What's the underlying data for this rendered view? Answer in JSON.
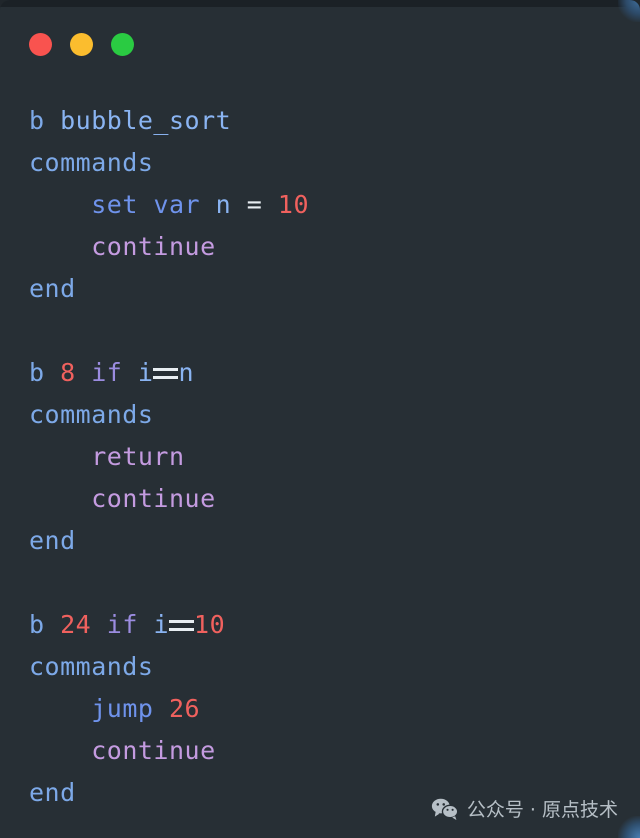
{
  "window": {
    "titlebar": {
      "buttons": [
        {
          "name": "close",
          "label": "Close",
          "color": "#f9534f"
        },
        {
          "name": "minimize",
          "label": "Minimize",
          "color": "#fbbd2e"
        },
        {
          "name": "maximize",
          "label": "Maximize",
          "color": "#2acb42"
        }
      ]
    },
    "background_color": "#272f35"
  },
  "editor": {
    "language": "debugger-script",
    "syntax_colors": {
      "command": "#7da9e8",
      "identifier": "#8ab4f2",
      "number": "#f0615e",
      "keyword": "#c49be0",
      "conditional": "#9b8ce0",
      "operator": "#e8eef2",
      "builtin": "#6f93ec"
    },
    "lines": [
      {
        "n": 1,
        "indent": 0,
        "tokens": [
          {
            "t": "b",
            "c": "cmd"
          },
          {
            "t": " ",
            "c": "plain"
          },
          {
            "t": "bubble_sort",
            "c": "ident"
          }
        ]
      },
      {
        "n": 2,
        "indent": 0,
        "tokens": [
          {
            "t": "commands",
            "c": "cmd"
          }
        ]
      },
      {
        "n": 3,
        "indent": 1,
        "tokens": [
          {
            "t": "set",
            "c": "set"
          },
          {
            "t": " ",
            "c": "plain"
          },
          {
            "t": "var",
            "c": "set"
          },
          {
            "t": " ",
            "c": "plain"
          },
          {
            "t": "n",
            "c": "ident"
          },
          {
            "t": " ",
            "c": "plain"
          },
          {
            "t": "=",
            "c": "op"
          },
          {
            "t": " ",
            "c": "plain"
          },
          {
            "t": "10",
            "c": "num"
          }
        ]
      },
      {
        "n": 4,
        "indent": 1,
        "tokens": [
          {
            "t": "continue",
            "c": "kw"
          }
        ]
      },
      {
        "n": 5,
        "indent": 0,
        "tokens": [
          {
            "t": "end",
            "c": "cmd"
          }
        ]
      },
      {
        "n": 6,
        "indent": 0,
        "blank": true,
        "tokens": []
      },
      {
        "n": 7,
        "indent": 0,
        "tokens": [
          {
            "t": "b",
            "c": "cmd"
          },
          {
            "t": " ",
            "c": "plain"
          },
          {
            "t": "8",
            "c": "num"
          },
          {
            "t": " ",
            "c": "plain"
          },
          {
            "t": "if",
            "c": "cond"
          },
          {
            "t": " ",
            "c": "plain"
          },
          {
            "t": "i",
            "c": "ident"
          },
          {
            "t": "==",
            "c": "eqeq"
          },
          {
            "t": "n",
            "c": "ident"
          }
        ]
      },
      {
        "n": 8,
        "indent": 0,
        "tokens": [
          {
            "t": "commands",
            "c": "cmd"
          }
        ]
      },
      {
        "n": 9,
        "indent": 1,
        "tokens": [
          {
            "t": "return",
            "c": "kw"
          }
        ]
      },
      {
        "n": 10,
        "indent": 1,
        "tokens": [
          {
            "t": "continue",
            "c": "kw"
          }
        ]
      },
      {
        "n": 11,
        "indent": 0,
        "tokens": [
          {
            "t": "end",
            "c": "cmd"
          }
        ]
      },
      {
        "n": 12,
        "indent": 0,
        "blank": true,
        "tokens": []
      },
      {
        "n": 13,
        "indent": 0,
        "tokens": [
          {
            "t": "b",
            "c": "cmd"
          },
          {
            "t": " ",
            "c": "plain"
          },
          {
            "t": "24",
            "c": "num"
          },
          {
            "t": " ",
            "c": "plain"
          },
          {
            "t": "if",
            "c": "cond"
          },
          {
            "t": " ",
            "c": "plain"
          },
          {
            "t": "i",
            "c": "ident"
          },
          {
            "t": "==",
            "c": "eqeq"
          },
          {
            "t": "10",
            "c": "num"
          }
        ]
      },
      {
        "n": 14,
        "indent": 0,
        "tokens": [
          {
            "t": "commands",
            "c": "cmd"
          }
        ]
      },
      {
        "n": 15,
        "indent": 1,
        "tokens": [
          {
            "t": "jump",
            "c": "set"
          },
          {
            "t": " ",
            "c": "plain"
          },
          {
            "t": "26",
            "c": "num"
          }
        ]
      },
      {
        "n": 16,
        "indent": 1,
        "tokens": [
          {
            "t": "continue",
            "c": "kw"
          }
        ]
      },
      {
        "n": 17,
        "indent": 0,
        "tokens": [
          {
            "t": "end",
            "c": "cmd"
          }
        ]
      }
    ]
  },
  "watermark": {
    "icon": "wechat-icon",
    "text": "公众号 · 原点技术"
  }
}
